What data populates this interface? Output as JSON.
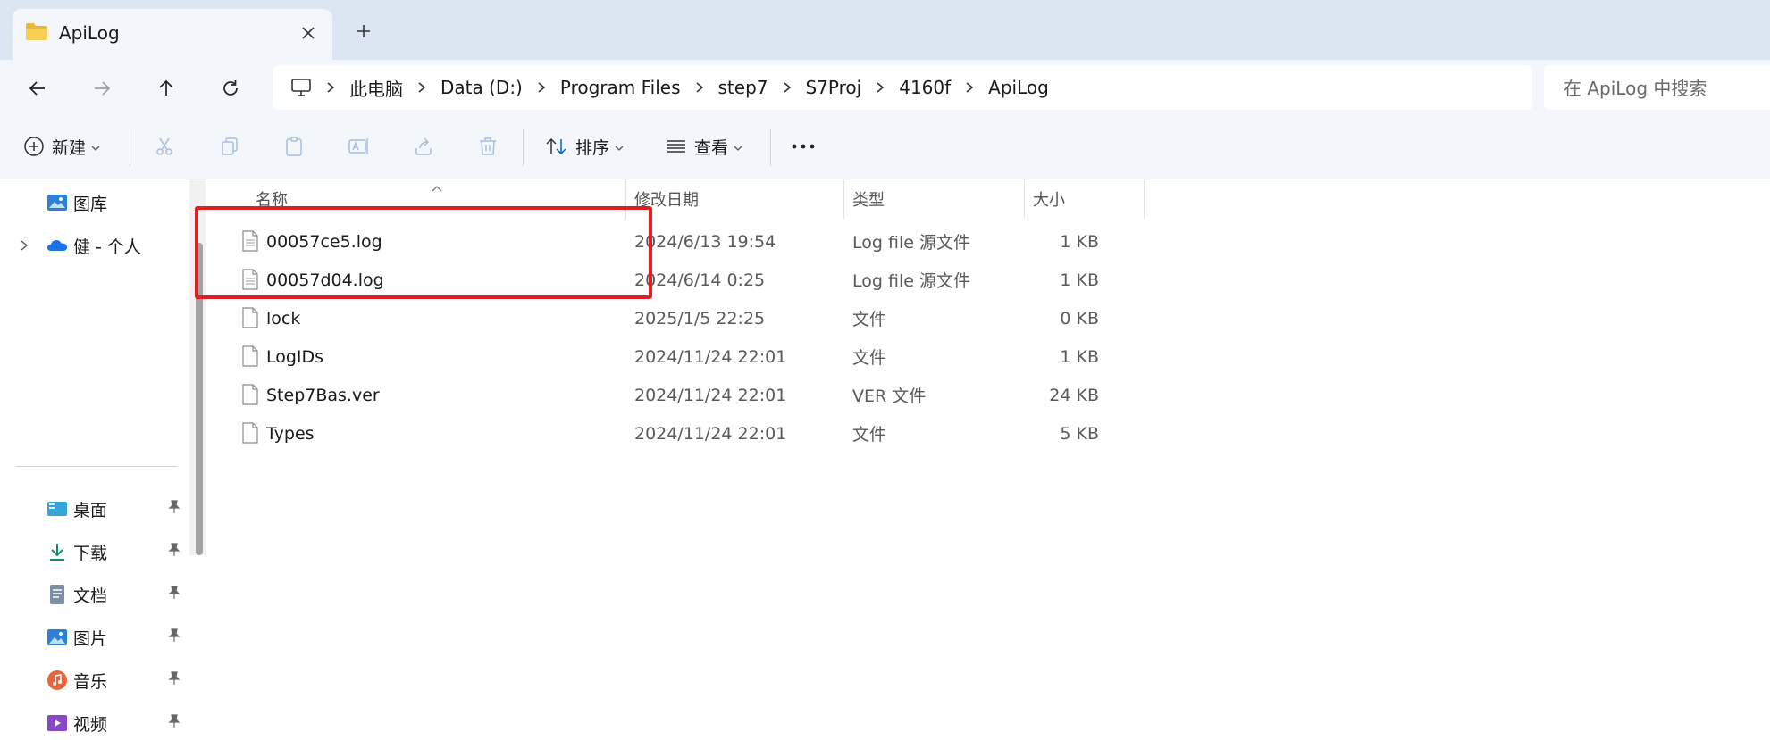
{
  "tab": {
    "title": "ApiLog"
  },
  "breadcrumbs": [
    "此电脑",
    "Data (D:)",
    "Program Files",
    "step7",
    "S7Proj",
    "4160f",
    "ApiLog"
  ],
  "search": {
    "placeholder": "在 ApiLog 中搜索"
  },
  "commands": {
    "new": "新建",
    "sort": "排序",
    "view": "查看"
  },
  "sidebar": {
    "items": [
      {
        "label": "图库",
        "icon": "gallery-icon",
        "pinned": false
      },
      {
        "label": "健 - 个人",
        "icon": "onedrive-icon",
        "pinned": false
      },
      {
        "label": "桌面",
        "icon": "desktop-icon",
        "pinned": true
      },
      {
        "label": "下载",
        "icon": "download-icon",
        "pinned": true
      },
      {
        "label": "文档",
        "icon": "documents-icon",
        "pinned": true
      },
      {
        "label": "图片",
        "icon": "pictures-icon",
        "pinned": true
      },
      {
        "label": "音乐",
        "icon": "music-icon",
        "pinned": true
      },
      {
        "label": "视频",
        "icon": "videos-icon",
        "pinned": true
      }
    ]
  },
  "columns": {
    "name": "名称",
    "date": "修改日期",
    "type": "类型",
    "size": "大小"
  },
  "files": [
    {
      "name": "00057ce5.log",
      "date": "2024/6/13 19:54",
      "type": "Log file 源文件",
      "size": "1 KB",
      "icon": "log-file-icon"
    },
    {
      "name": "00057d04.log",
      "date": "2024/6/14 0:25",
      "type": "Log file 源文件",
      "size": "1 KB",
      "icon": "log-file-icon"
    },
    {
      "name": "lock",
      "date": "2025/1/5 22:25",
      "type": "文件",
      "size": "0 KB",
      "icon": "file-icon"
    },
    {
      "name": "LogIDs",
      "date": "2024/11/24 22:01",
      "type": "文件",
      "size": "1 KB",
      "icon": "file-icon"
    },
    {
      "name": "Step7Bas.ver",
      "date": "2024/11/24 22:01",
      "type": "VER 文件",
      "size": "24 KB",
      "icon": "file-icon"
    },
    {
      "name": "Types",
      "date": "2024/11/24 22:01",
      "type": "文件",
      "size": "5 KB",
      "icon": "file-icon"
    }
  ],
  "colors": {
    "highlight": "#e02020",
    "accent": "#0067c0",
    "chrome": "#f3f6fb"
  }
}
